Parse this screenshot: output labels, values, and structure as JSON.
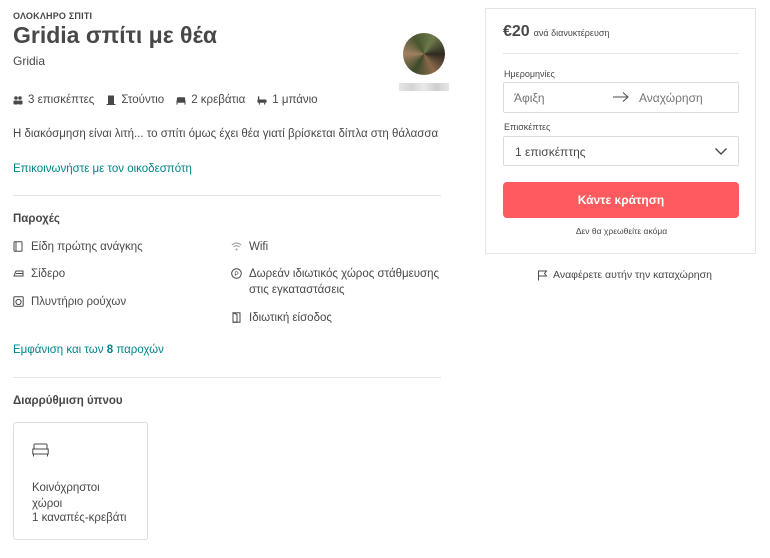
{
  "listing": {
    "type_label": "ΟΛΟΚΛΗΡΟ ΣΠΙΤΙ",
    "title": "Gridia σπίτι με θέα",
    "city": "Gridia",
    "stats": {
      "guests": "3 επισκέπτες",
      "room_type": "Στούντιο",
      "beds": "2 κρεβάτια",
      "baths": "1 μπάνιο"
    },
    "description": "Η διακόσμηση είναι λιτή... το σπίτι όμως έχει θέα γιατί βρίσκεται δίπλα στη θάλασσα",
    "contact_host": "Επικοινωνήστε με τον οικοδεσπότη"
  },
  "amenities": {
    "title": "Παροχές",
    "left": [
      {
        "label": "Είδη πρώτης ανάγκης",
        "icon": "essentials-icon"
      },
      {
        "label": "Σίδερο",
        "icon": "iron-icon"
      },
      {
        "label": "Πλυντήριο ρούχων",
        "icon": "washer-icon"
      }
    ],
    "right": [
      {
        "label": "Wifi",
        "icon": "wifi-icon"
      },
      {
        "label": "Δωρεάν ιδιωτικός χώρος στάθμευσης στις εγκαταστάσεις",
        "icon": "parking-icon"
      },
      {
        "label": "Ιδιωτική είσοδος",
        "icon": "private-entrance-icon"
      }
    ],
    "show_all_prefix": "Εμφάνιση και των ",
    "show_all_count": "8",
    "show_all_suffix": " παροχών"
  },
  "sleeping": {
    "title": "Διαρρύθμιση ύπνου",
    "card": {
      "room": "Κοινόχρηστοι χώροι",
      "beds": "1 καναπές-κρεβάτι",
      "icon": "bed-icon"
    }
  },
  "booking": {
    "price": "€20",
    "per_night": "ανά διανυκτέρευση",
    "dates_label": "Ημερομηνίες",
    "checkin_placeholder": "Άφιξη",
    "checkout_placeholder": "Αναχώρηση",
    "guests_label": "Επισκέπτες",
    "guests_value": "1 επισκέπτης",
    "book_button": "Κάντε κράτηση",
    "no_charge": "Δεν θα χρεωθείτε ακόμα"
  },
  "report": {
    "label": "Αναφέρετε αυτήν την καταχώρηση",
    "icon": "flag-icon"
  },
  "colors": {
    "accent_link": "#008489",
    "book_button": "#ff5a5f",
    "text": "#484848"
  }
}
